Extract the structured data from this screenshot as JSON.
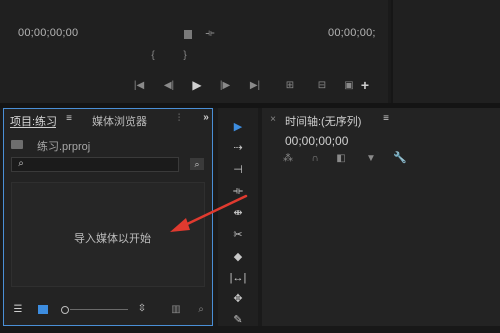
{
  "source_monitor": {
    "timecode_left": "00;00;00;00"
  },
  "program_monitor": {
    "timecode_right": "00;00;00;"
  },
  "transport": {
    "icons": [
      "marker-icon",
      "in-point-icon",
      "out-point-icon",
      "go-to-in-icon",
      "step-back-icon",
      "play-icon",
      "step-forward-icon",
      "go-to-out-icon",
      "insert-icon",
      "overwrite-icon",
      "export-frame-icon",
      "add-button-icon"
    ]
  },
  "project_panel": {
    "tab_project": "项目:练习",
    "tab_media_browser": "媒体浏览器",
    "file_name": "练习.prproj",
    "empty_hint": "导入媒体以开始",
    "search_placeholder": ""
  },
  "timeline_panel": {
    "tab_title": "时间轴:(无序列)",
    "timecode": "00;00;00;00"
  },
  "colors": {
    "accent": "#3d8de0",
    "arrow": "#e03a2f",
    "panel_border_active": "#4a8fd6"
  }
}
